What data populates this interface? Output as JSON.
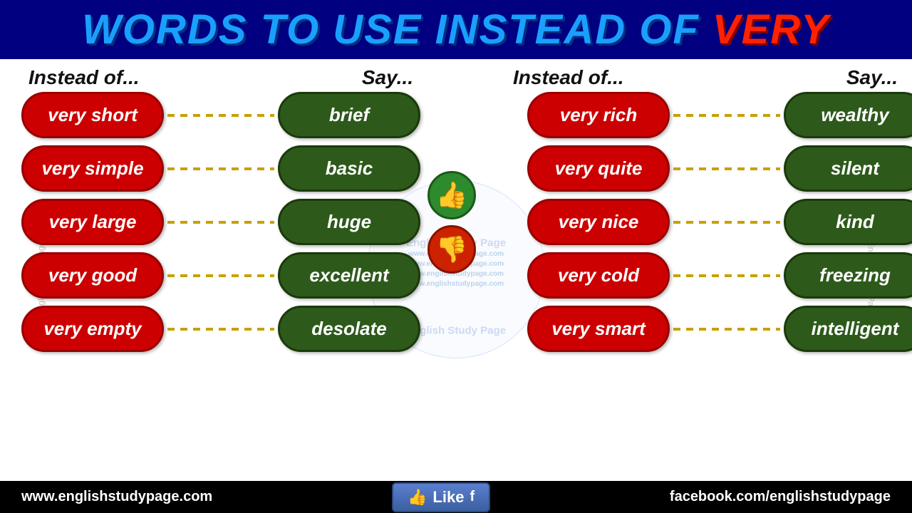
{
  "header": {
    "title_blue": "WORDS TO USE INSTEAD OF ",
    "title_red": "VERY"
  },
  "columns": {
    "instead_of": "Instead of...",
    "say": "Say..."
  },
  "left_pairs": [
    {
      "instead": "very short",
      "say": "brief"
    },
    {
      "instead": "very simple",
      "say": "basic"
    },
    {
      "instead": "very large",
      "say": "huge"
    },
    {
      "instead": "very good",
      "say": "excellent"
    },
    {
      "instead": "very empty",
      "say": "desolate"
    }
  ],
  "right_pairs": [
    {
      "instead": "very rich",
      "say": "wealthy"
    },
    {
      "instead": "very quite",
      "say": "silent"
    },
    {
      "instead": "very nice",
      "say": "kind"
    },
    {
      "instead": "very cold",
      "say": "freezing"
    },
    {
      "instead": "very smart",
      "say": "intelligent"
    }
  ],
  "watermark": {
    "top": "English Study Page",
    "bottom": "English Study Page",
    "circular": "www.englishstudypage.com",
    "side": "English Study Page"
  },
  "footer": {
    "website": "www.englishstudypage.com",
    "facebook": "facebook.com/englishstudypage",
    "like_label": "Like"
  },
  "icons": {
    "thumbs_up": "👍",
    "thumbs_down": "👎",
    "fb": "f"
  }
}
